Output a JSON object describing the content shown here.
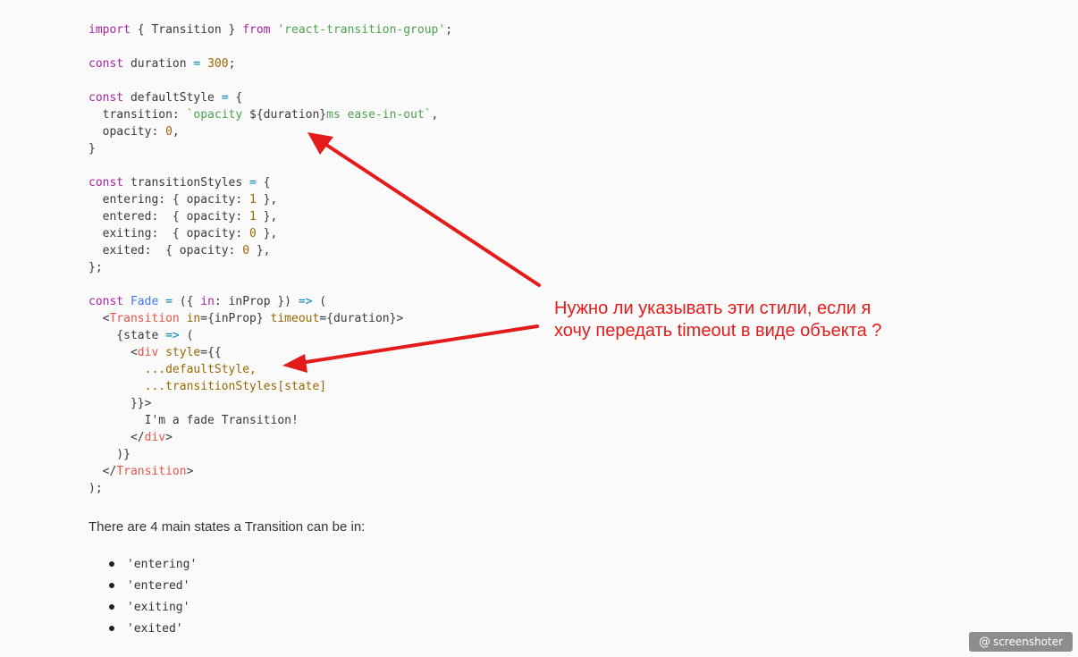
{
  "code": {
    "lines": [
      [
        {
          "c": "kw",
          "t": "import"
        },
        {
          "c": "plain",
          "t": " { Transition } "
        },
        {
          "c": "kw",
          "t": "from"
        },
        {
          "c": "plain",
          "t": " "
        },
        {
          "c": "str",
          "t": "'react-transition-group'"
        },
        {
          "c": "plain",
          "t": ";"
        }
      ],
      [],
      [
        {
          "c": "kw",
          "t": "const"
        },
        {
          "c": "plain",
          "t": " duration "
        },
        {
          "c": "op",
          "t": "="
        },
        {
          "c": "plain",
          "t": " "
        },
        {
          "c": "num",
          "t": "300"
        },
        {
          "c": "plain",
          "t": ";"
        }
      ],
      [],
      [
        {
          "c": "kw",
          "t": "const"
        },
        {
          "c": "plain",
          "t": " defaultStyle "
        },
        {
          "c": "op",
          "t": "="
        },
        {
          "c": "plain",
          "t": " {"
        }
      ],
      [
        {
          "c": "plain",
          "t": "  transition: "
        },
        {
          "c": "str",
          "t": "`opacity "
        },
        {
          "c": "plain",
          "t": "${duration}"
        },
        {
          "c": "str",
          "t": "ms ease-in-out`"
        },
        {
          "c": "plain",
          "t": ","
        }
      ],
      [
        {
          "c": "plain",
          "t": "  opacity: "
        },
        {
          "c": "num",
          "t": "0"
        },
        {
          "c": "plain",
          "t": ","
        }
      ],
      [
        {
          "c": "plain",
          "t": "}"
        }
      ],
      [],
      [
        {
          "c": "kw",
          "t": "const"
        },
        {
          "c": "plain",
          "t": " transitionStyles "
        },
        {
          "c": "op",
          "t": "="
        },
        {
          "c": "plain",
          "t": " {"
        }
      ],
      [
        {
          "c": "plain",
          "t": "  entering: { opacity: "
        },
        {
          "c": "num",
          "t": "1"
        },
        {
          "c": "plain",
          "t": " },"
        }
      ],
      [
        {
          "c": "plain",
          "t": "  entered:  { opacity: "
        },
        {
          "c": "num",
          "t": "1"
        },
        {
          "c": "plain",
          "t": " },"
        }
      ],
      [
        {
          "c": "plain",
          "t": "  exiting:  { opacity: "
        },
        {
          "c": "num",
          "t": "0"
        },
        {
          "c": "plain",
          "t": " },"
        }
      ],
      [
        {
          "c": "plain",
          "t": "  exited:  { opacity: "
        },
        {
          "c": "num",
          "t": "0"
        },
        {
          "c": "plain",
          "t": " },"
        }
      ],
      [
        {
          "c": "plain",
          "t": "};"
        }
      ],
      [],
      [
        {
          "c": "kw",
          "t": "const"
        },
        {
          "c": "plain",
          "t": " "
        },
        {
          "c": "fn",
          "t": "Fade"
        },
        {
          "c": "plain",
          "t": " "
        },
        {
          "c": "op",
          "t": "="
        },
        {
          "c": "plain",
          "t": " ({ "
        },
        {
          "c": "kw",
          "t": "in"
        },
        {
          "c": "plain",
          "t": ": inProp }) "
        },
        {
          "c": "op",
          "t": "=>"
        },
        {
          "c": "plain",
          "t": " ("
        }
      ],
      [
        {
          "c": "plain",
          "t": "  <"
        },
        {
          "c": "tag",
          "t": "Transition"
        },
        {
          "c": "plain",
          "t": " "
        },
        {
          "c": "attr",
          "t": "in"
        },
        {
          "c": "plain",
          "t": "="
        },
        {
          "c": "plain",
          "t": "{inProp}"
        },
        {
          "c": "plain",
          "t": " "
        },
        {
          "c": "attr",
          "t": "timeout"
        },
        {
          "c": "plain",
          "t": "="
        },
        {
          "c": "plain",
          "t": "{duration}"
        },
        {
          "c": "plain",
          "t": ">"
        }
      ],
      [
        {
          "c": "plain",
          "t": "    {state "
        },
        {
          "c": "op",
          "t": "=>"
        },
        {
          "c": "plain",
          "t": " ("
        }
      ],
      [
        {
          "c": "plain",
          "t": "      <"
        },
        {
          "c": "tag",
          "t": "div"
        },
        {
          "c": "plain",
          "t": " "
        },
        {
          "c": "attr",
          "t": "style"
        },
        {
          "c": "plain",
          "t": "={{"
        }
      ],
      [
        {
          "c": "plain",
          "t": "        "
        },
        {
          "c": "num",
          "t": "...defaultStyle,"
        }
      ],
      [
        {
          "c": "plain",
          "t": "        "
        },
        {
          "c": "num",
          "t": "...transitionStyles[state]"
        }
      ],
      [
        {
          "c": "plain",
          "t": "      }}>"
        }
      ],
      [
        {
          "c": "plain",
          "t": "        I'm a fade Transition!"
        }
      ],
      [
        {
          "c": "plain",
          "t": "      </"
        },
        {
          "c": "tag",
          "t": "div"
        },
        {
          "c": "plain",
          "t": ">"
        }
      ],
      [
        {
          "c": "plain",
          "t": "    )}"
        }
      ],
      [
        {
          "c": "plain",
          "t": "  </"
        },
        {
          "c": "tag",
          "t": "Transition"
        },
        {
          "c": "plain",
          "t": ">"
        }
      ],
      [
        {
          "c": "plain",
          "t": ");"
        }
      ]
    ]
  },
  "paragraph": "There are 4 main states a Transition can be in:",
  "states": [
    "'entering'",
    "'entered'",
    "'exiting'",
    "'exited'"
  ],
  "annotation": {
    "line1": "Нужно ли указывать эти стили, если я",
    "line2": "хочу передать timeout в виде объекта ?",
    "color": "#e31b1b"
  },
  "badge": {
    "icon": "at-icon",
    "label": "screenshoter"
  },
  "colors": {
    "background": "#fafafa",
    "keyword": "#a626a4",
    "string": "#50a14f",
    "number": "#986801",
    "operator": "#0184bc",
    "tag": "#e45649",
    "arrow": "#e31b1b"
  }
}
